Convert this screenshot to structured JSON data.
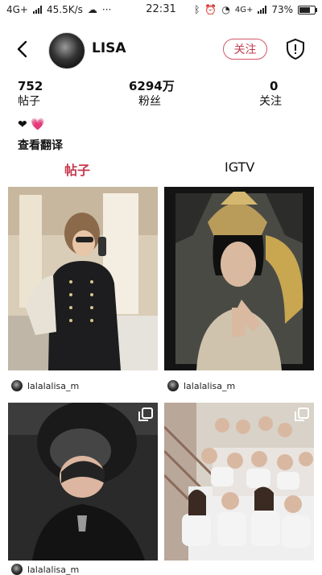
{
  "status_bar": {
    "network_left": "4G+",
    "speed": "45.5K/s",
    "time": "22:31",
    "network_right": "4G+",
    "battery": "73%"
  },
  "profile": {
    "username": "LISA",
    "follow_label": "关注",
    "stats": [
      {
        "value": "752",
        "label": "帖子"
      },
      {
        "value": "6294万",
        "label": "粉丝"
      },
      {
        "value": "0",
        "label": "关注"
      }
    ],
    "bio_emojis": [
      "❤",
      "💗"
    ],
    "translate_label": "查看翻译"
  },
  "tabs": [
    {
      "label": "帖子",
      "active": true
    },
    {
      "label": "IGTV",
      "active": false
    }
  ],
  "posts": [
    {
      "author": "lalalalisa_m",
      "multi": false
    },
    {
      "author": "lalalalisa_m",
      "multi": false
    },
    {
      "author": "lalalalisa_m",
      "multi": true
    },
    {
      "author": "",
      "multi": true
    }
  ],
  "colors": {
    "accent": "#c63a4d",
    "pink_heart": "#ff5fa8"
  }
}
